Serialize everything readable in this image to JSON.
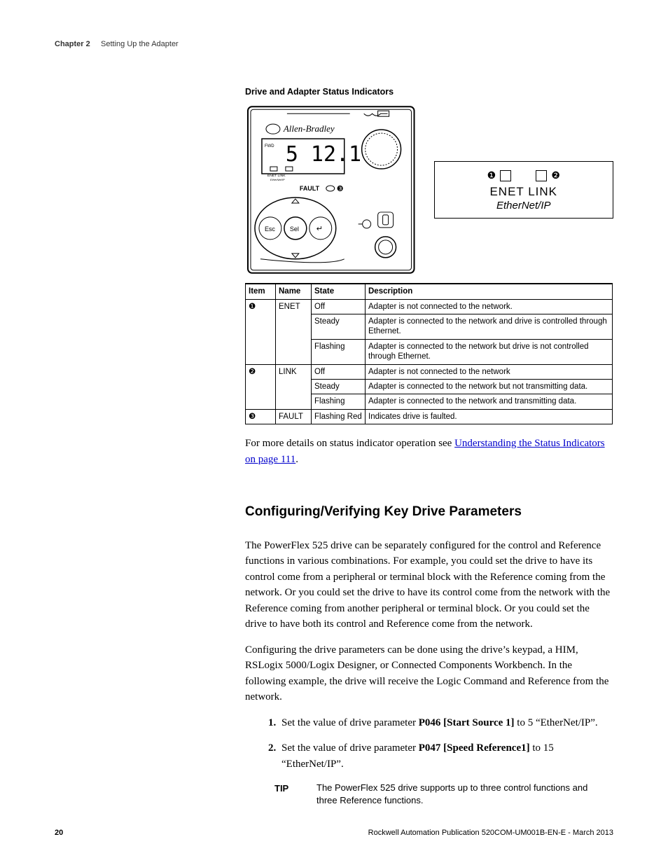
{
  "header": {
    "chapter": "Chapter 2",
    "title": "Setting Up the Adapter"
  },
  "figure": {
    "title": "Drive and Adapter Status Indicators",
    "device_brand": "Allen-Bradley",
    "device_text": {
      "fwd": "FWD",
      "enet_label": "ENET",
      "link_label": "LINK",
      "enet_small": "EtherNet/IP",
      "fault": "FAULT",
      "esc": "Esc",
      "sel": "Sel"
    },
    "callout": {
      "n1": "❶",
      "n2": "❷",
      "line2": "ENET  LINK",
      "line3": "EtherNet/IP"
    }
  },
  "table": {
    "headers": [
      "Item",
      "Name",
      "State",
      "Description"
    ],
    "rows": [
      {
        "item": "❶",
        "name": "ENET",
        "spans": 3,
        "states": [
          {
            "state": "Off",
            "desc": "Adapter is not connected to the network."
          },
          {
            "state": "Steady",
            "desc": "Adapter is connected to the network and drive is controlled through Ethernet."
          },
          {
            "state": "Flashing",
            "desc": "Adapter is connected to the network but drive is not controlled through Ethernet."
          }
        ]
      },
      {
        "item": "❷",
        "name": "LINK",
        "spans": 3,
        "states": [
          {
            "state": "Off",
            "desc": "Adapter is not connected to the network"
          },
          {
            "state": "Steady",
            "desc": "Adapter is connected to the network but not transmitting data."
          },
          {
            "state": "Flashing",
            "desc": "Adapter is connected to the network and transmitting data."
          }
        ]
      },
      {
        "item": "❸",
        "name": "FAULT",
        "spans": 1,
        "states": [
          {
            "state": "Flashing Red",
            "desc": "Indicates drive is faulted."
          }
        ]
      }
    ]
  },
  "para1_a": "For more details on status indicator operation see ",
  "para1_link": "Understanding the Status Indicators on page 111",
  "para1_b": ".",
  "section_heading": "Configuring/Verifying Key Drive Parameters",
  "para2": "The PowerFlex 525 drive can be separately configured for the control and Reference functions in various combinations.  For example, you could set the drive to have its control come from a peripheral or terminal block with the Reference coming from the network. Or you could set the drive to have its control come from the network with the Reference coming from another peripheral or terminal block. Or you could set the drive to have both its control and Reference come from the network.",
  "para3": "Configuring the drive parameters can be done using the drive’s keypad, a HIM, RSLogix 5000/Logix Designer, or Connected Components Workbench. In the following example, the drive will receive the Logic Command and Reference from the network.",
  "steps": [
    {
      "pre": "Set the value of drive parameter ",
      "bold": "P046 [Start Source 1]",
      "post": " to 5 “EtherNet/IP”."
    },
    {
      "pre": "Set the value of drive parameter ",
      "bold": "P047 [Speed Reference1]",
      "post": " to 15 “EtherNet/IP”."
    }
  ],
  "tip": {
    "label": "TIP",
    "body": "The PowerFlex 525 drive supports up to three control functions and three Reference functions."
  },
  "footer": {
    "page": "20",
    "pub": "Rockwell Automation Publication 520COM-UM001B-EN-E - March 2013"
  }
}
